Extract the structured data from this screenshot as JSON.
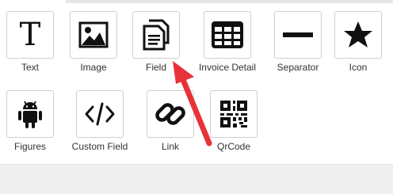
{
  "toolbox": {
    "items": [
      {
        "label": "Text",
        "icon": "text-icon"
      },
      {
        "label": "Image",
        "icon": "image-icon"
      },
      {
        "label": "Field",
        "icon": "field-icon"
      },
      {
        "label": "Invoice Detail",
        "icon": "table-grid-icon"
      },
      {
        "label": "Separator",
        "icon": "separator-line-icon"
      },
      {
        "label": "Icon",
        "icon": "star-icon"
      },
      {
        "label": "Figures",
        "icon": "android-icon"
      },
      {
        "label": "Custom Field",
        "icon": "code-icon"
      },
      {
        "label": "Link",
        "icon": "link-icon"
      },
      {
        "label": "QrCode",
        "icon": "qrcode-icon"
      }
    ],
    "text_glyph": "T"
  },
  "colors": {
    "icon": "#111111",
    "label": "#333333",
    "arrow": "#e8323a",
    "border": "#cfcfcf"
  }
}
